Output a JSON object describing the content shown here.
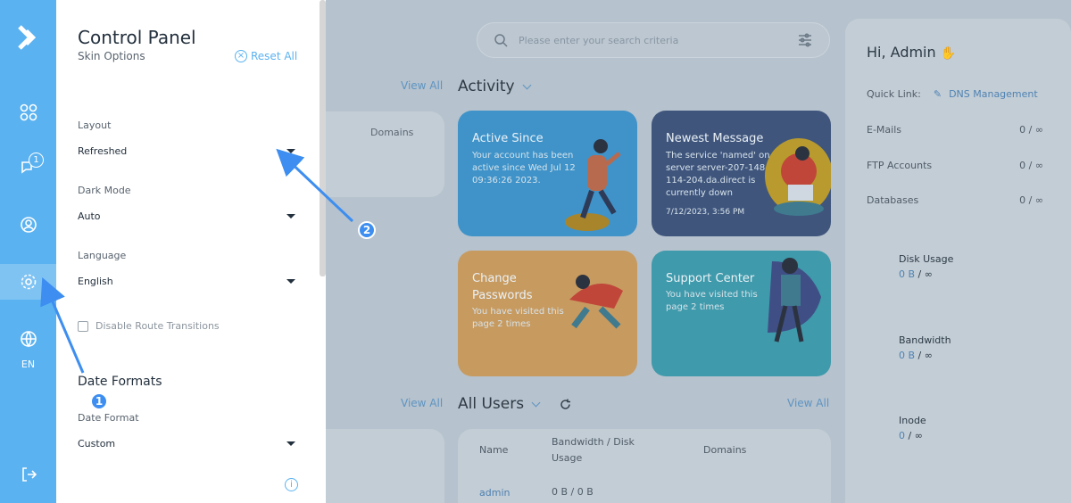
{
  "rail": {
    "badge": "1",
    "lang": "EN"
  },
  "drawer": {
    "title": "Control Panel",
    "subtitle": "Skin Options",
    "reset": "Reset All",
    "layout_label": "Layout",
    "layout_value": "Refreshed",
    "dark_label": "Dark Mode",
    "dark_value": "Auto",
    "lang_label": "Language",
    "lang_value": "English",
    "disable_transitions": "Disable Route Transitions",
    "date_formats_title": "Date Formats",
    "date_format_label": "Date Format",
    "date_format_value": "Custom",
    "info": "i"
  },
  "search": {
    "placeholder": "Please enter your search criteria"
  },
  "activity": {
    "title": "Activity",
    "view_all_left": "View All",
    "cards": [
      {
        "title": "Active Since",
        "body": "Your account has been active since Wed Jul 12 09:36:26 2023.",
        "color": "#3f93c9"
      },
      {
        "title": "Newest Message",
        "body": "The service 'named' on server server-207-148-114-204.da.direct is currently down",
        "date": "7/12/2023, 3:56 PM",
        "color": "#3f557c"
      },
      {
        "title": "Change Passwords",
        "body": "You have visited this page 2 times",
        "color": "#c79a5f"
      },
      {
        "title": "Support Center",
        "body": "You have visited this page 2 times",
        "color": "#3f9aab"
      }
    ]
  },
  "domains_ghost": "Domains",
  "users": {
    "title": "All Users",
    "view_all_left": "View All",
    "view_all_right": "View All",
    "col_name": "Name",
    "col_bw": "Bandwidth / Disk Usage",
    "col_domains": "Domains",
    "row_name": "admin",
    "row_bw": "0 B / 0 B"
  },
  "right": {
    "greeting": "Hi, Admin",
    "quick_link_label": "Quick Link:",
    "quick_link": "DNS Management",
    "emails_label": "E-Mails",
    "emails_value": "0 / ∞",
    "ftp_label": "FTP Accounts",
    "ftp_value": "0 / ∞",
    "db_label": "Databases",
    "db_value": "0 / ∞",
    "disk_label": "Disk Usage",
    "disk_used": "0 B",
    "disk_sep": "/ ∞",
    "bw_label": "Bandwidth",
    "bw_used": "0 B",
    "bw_sep": "/ ∞",
    "inode_label": "Inode",
    "inode_used": "0",
    "inode_sep": "/ ∞"
  },
  "annotations": {
    "one": "1",
    "two": "2"
  }
}
